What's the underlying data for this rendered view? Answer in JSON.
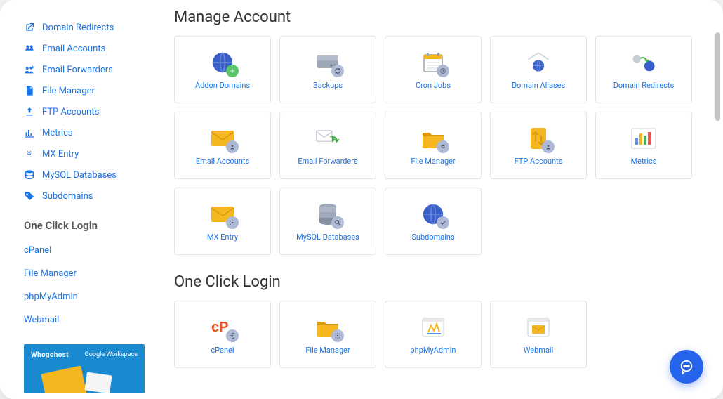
{
  "sidebar": {
    "items": [
      {
        "label": "Domain Redirects",
        "icon": "redirect-icon"
      },
      {
        "label": "Email Accounts",
        "icon": "users-icon"
      },
      {
        "label": "Email Forwarders",
        "icon": "forward-icon"
      },
      {
        "label": "File Manager",
        "icon": "file-icon"
      },
      {
        "label": "FTP Accounts",
        "icon": "upload-icon"
      },
      {
        "label": "Metrics",
        "icon": "chart-icon"
      },
      {
        "label": "MX Entry",
        "icon": "mx-icon"
      },
      {
        "label": "MySQL Databases",
        "icon": "db-icon"
      },
      {
        "label": "Subdomains",
        "icon": "tag-icon"
      }
    ],
    "section2_title": "One Click Login",
    "ocl_items": [
      {
        "label": "cPanel"
      },
      {
        "label": "File Manager"
      },
      {
        "label": "phpMyAdmin"
      },
      {
        "label": "Webmail"
      }
    ],
    "promo": {
      "brand": "Whogohost",
      "partner": "Google Workspace"
    }
  },
  "main": {
    "section1_title": "Manage Account",
    "section2_title": "One Click Login",
    "manage_cards": [
      {
        "label": "Addon Domains"
      },
      {
        "label": "Backups"
      },
      {
        "label": "Cron Jobs"
      },
      {
        "label": "Domain Aliases"
      },
      {
        "label": "Domain Redirects"
      },
      {
        "label": "Email Accounts"
      },
      {
        "label": "Email Forwarders"
      },
      {
        "label": "File Manager"
      },
      {
        "label": "FTP Accounts"
      },
      {
        "label": "Metrics"
      },
      {
        "label": "MX Entry"
      },
      {
        "label": "MySQL Databases"
      },
      {
        "label": "Subdomains"
      }
    ],
    "ocl_cards": [
      {
        "label": "cPanel"
      },
      {
        "label": "File Manager"
      },
      {
        "label": "phpMyAdmin"
      },
      {
        "label": "Webmail"
      }
    ]
  },
  "colors": {
    "link": "#1a73e8",
    "accent": "#2563eb",
    "badge": "#aeb9d6"
  }
}
